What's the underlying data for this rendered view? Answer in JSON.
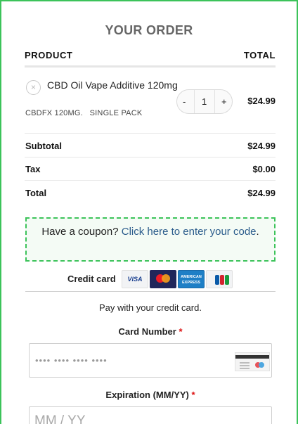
{
  "order": {
    "title": "YOUR ORDER",
    "header_product": "PRODUCT",
    "header_total": "TOTAL"
  },
  "item": {
    "remove_symbol": "×",
    "name": "CBD Oil Vape Additive 120mg",
    "meta": "CBDFX 120MG.   SINGLE PACK",
    "quantity": "1",
    "minus": "-",
    "plus": "+",
    "price": "$24.99"
  },
  "totals": [
    {
      "label": "Subtotal",
      "value": "$24.99"
    },
    {
      "label": "Tax",
      "value": "$0.00"
    },
    {
      "label": "Total",
      "value": "$24.99"
    }
  ],
  "coupon": {
    "prompt": "Have a coupon?",
    "link": "Click here to enter your code",
    "suffix": "."
  },
  "payment": {
    "method_label": "Credit card",
    "card_brands": [
      "visa-icon",
      "mastercard-icon",
      "amex-icon",
      "jcb-icon"
    ],
    "visa_text": "VISA",
    "amex_text": "AMERICAN EXPRESS",
    "description": "Pay with your credit card.",
    "card_number_label": "Card Number",
    "card_number_placeholder": "•••• •••• •••• ••••",
    "expiration_label": "Expiration (MM/YY)",
    "expiration_placeholder": "MM / YY",
    "required_mark": "*"
  },
  "colors": {
    "accent_border": "#3cc35a",
    "link": "#2b5c8c",
    "required": "#dd1111"
  }
}
